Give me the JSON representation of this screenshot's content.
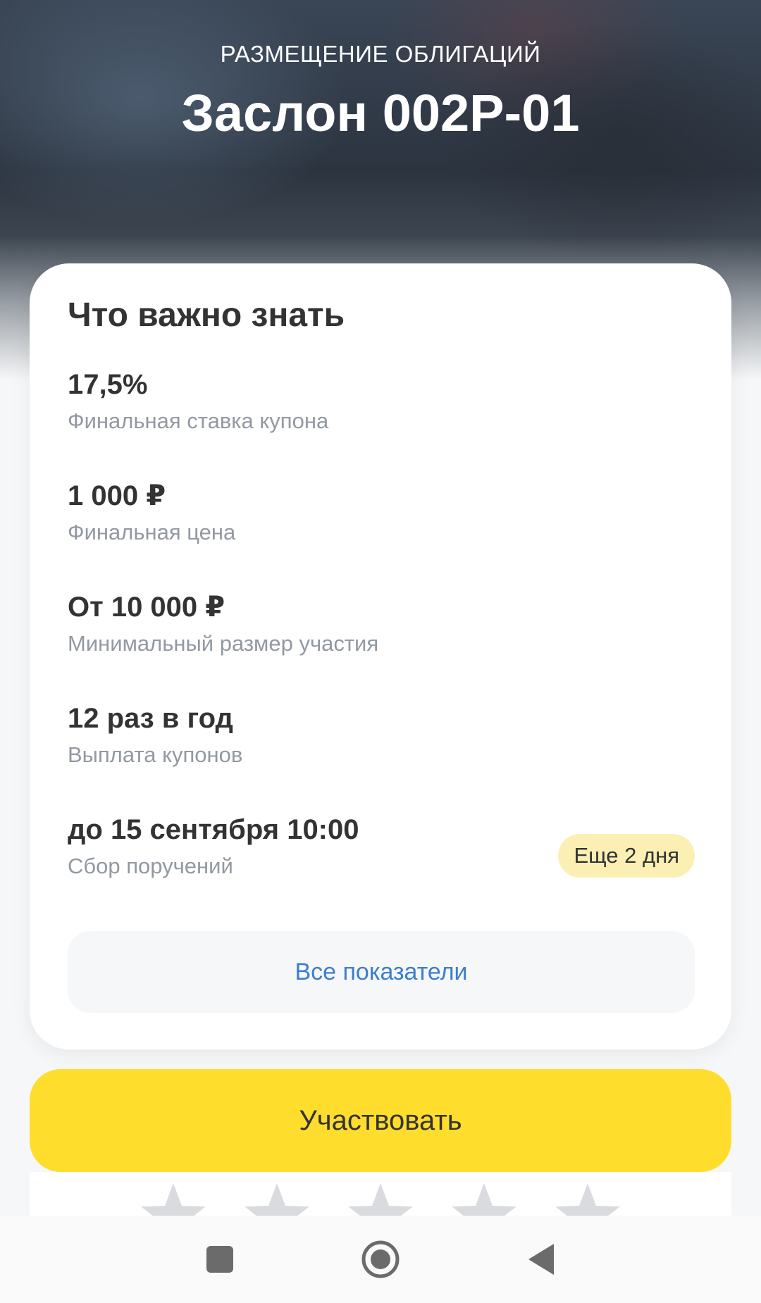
{
  "hero": {
    "eyebrow": "РАЗМЕЩЕНИЕ ОБЛИГАЦИЙ",
    "title": "Заслон 002P-01"
  },
  "card": {
    "title": "Что важно знать",
    "facts": [
      {
        "value": "17,5%",
        "label": "Финальная ставка купона"
      },
      {
        "value": "1 000 ₽",
        "label": "Финальная цена"
      },
      {
        "value": "От 10 000 ₽",
        "label": "Минимальный размер участия"
      },
      {
        "value": "12 раз в год",
        "label": "Выплата купонов"
      },
      {
        "value": "до 15 сентября 10:00",
        "label": "Сбор поручений"
      }
    ],
    "deadline_badge": "Еще 2 дня",
    "all_metrics_label": "Все показатели"
  },
  "participate_label": "Участвовать",
  "rating": {
    "stars_total": 5,
    "stars_filled": 0,
    "star_icon": "star-icon"
  },
  "navbar": {
    "icons": [
      "square-recents-icon",
      "circle-home-icon",
      "triangle-back-icon"
    ]
  },
  "colors": {
    "accent": "#ffdd2d",
    "link": "#3c7ed0",
    "badge_bg": "#fcefb4",
    "text_primary": "#333333",
    "text_secondary": "#9299a2"
  }
}
